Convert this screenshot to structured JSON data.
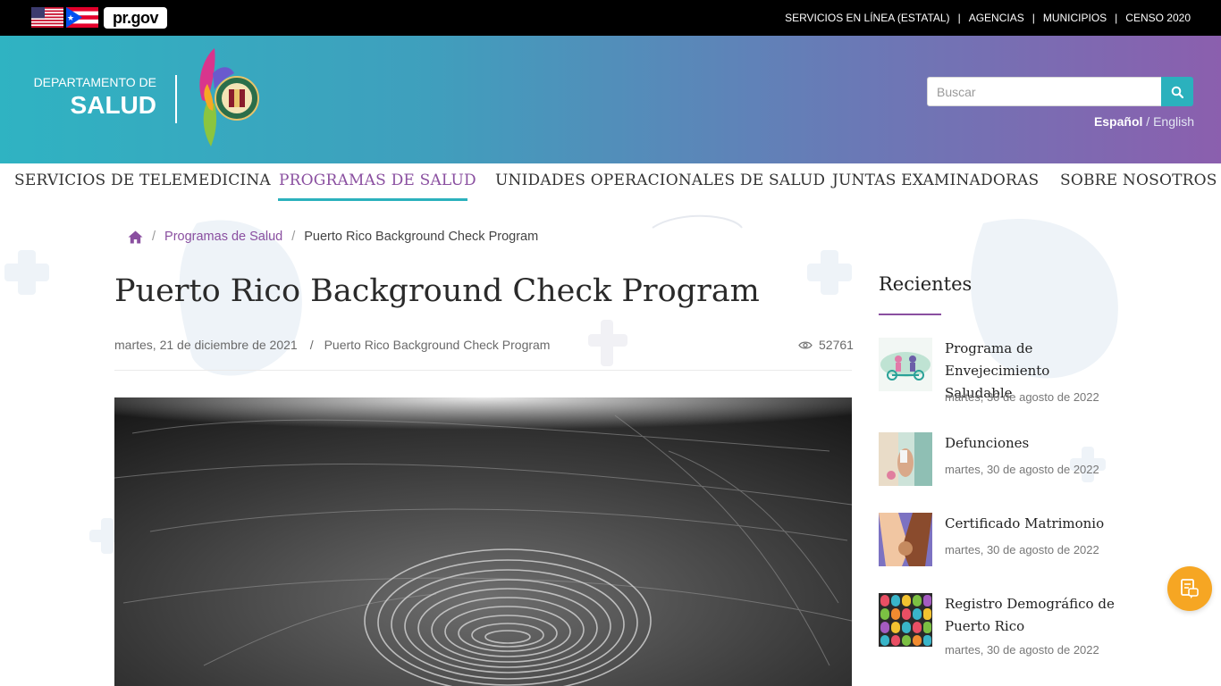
{
  "topbar": {
    "brand": "pr.gov",
    "links": [
      "SERVICIOS EN LÍNEA (ESTATAL)",
      "AGENCIAS",
      "MUNICIPIOS",
      "CENSO 2020"
    ],
    "separator": "|"
  },
  "header": {
    "dept_small": "DEPARTAMENTO DE",
    "dept_big": "SALUD",
    "search_placeholder": "Buscar",
    "lang_es": "Español",
    "lang_sep": " / ",
    "lang_en": "English"
  },
  "nav": {
    "items": [
      "SERVICIOS DE TELEMEDICINA",
      "PROGRAMAS DE SALUD",
      "UNIDADES OPERACIONALES DE SALUD",
      "JUNTAS EXAMINADORAS",
      "SOBRE NOSOTROS"
    ],
    "active_index": 1
  },
  "breadcrumb": {
    "separator": "/",
    "level1": "Programas de Salud",
    "current": "Puerto Rico Background Check Program"
  },
  "article": {
    "title": "Puerto Rico Background Check Program",
    "date": "martes, 21 de diciembre de 2021",
    "meta_sep": "/",
    "category": "Puerto Rico Background Check Program",
    "views": "52761"
  },
  "sidebar": {
    "title": "Recientes",
    "posts": [
      {
        "title": "Programa de Envejecimiento Saludable",
        "date": "martes, 30 de agosto de 2022"
      },
      {
        "title": "Defunciones",
        "date": "martes, 30 de agosto de 2022"
      },
      {
        "title": "Certificado Matrimonio",
        "date": "martes, 30 de agosto de 2022"
      },
      {
        "title": "Registro Demográfico de Puerto Rico",
        "date": "martes, 30 de agosto de 2022"
      }
    ]
  },
  "colors": {
    "accent_purple": "#8a4fa0",
    "accent_teal": "#2bb1bd",
    "fab_orange": "#f6a623"
  },
  "icons": [
    "us-flag-icon",
    "pr-flag-icon",
    "search-icon",
    "home-icon",
    "eye-icon",
    "chat-document-icon"
  ]
}
